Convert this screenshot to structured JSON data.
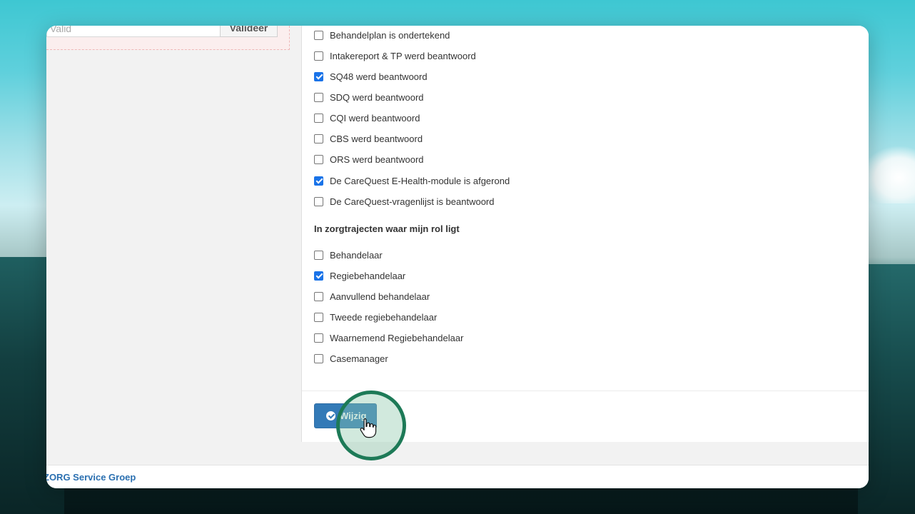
{
  "left_pane": {
    "validate_input_placeholder": "Valid",
    "validate_button_label": "Valideer"
  },
  "status_checkboxes": [
    {
      "label": "Behandelplan is ondertekend",
      "checked": false
    },
    {
      "label": "Intakereport & TP werd beantwoord",
      "checked": false
    },
    {
      "label": "SQ48 werd beantwoord",
      "checked": true
    },
    {
      "label": "SDQ werd beantwoord",
      "checked": false
    },
    {
      "label": "CQI werd beantwoord",
      "checked": false
    },
    {
      "label": "CBS werd beantwoord",
      "checked": false
    },
    {
      "label": "ORS werd beantwoord",
      "checked": false
    },
    {
      "label": "De CareQuest E-Health-module is afgerond",
      "checked": true
    },
    {
      "label": "De CareQuest-vragenlijst is beantwoord",
      "checked": false
    }
  ],
  "role_section": {
    "heading": "In zorgtrajecten waar mijn rol ligt",
    "roles": [
      {
        "label": "Behandelaar",
        "checked": false
      },
      {
        "label": "Regiebehandelaar",
        "checked": true
      },
      {
        "label": "Aanvullend behandelaar",
        "checked": false
      },
      {
        "label": "Tweede regiebehandelaar",
        "checked": false
      },
      {
        "label": "Waarnemend Regiebehandelaar",
        "checked": false
      },
      {
        "label": "Casemanager",
        "checked": false
      }
    ]
  },
  "form_footer": {
    "submit_label": "Wijzig",
    "submit_icon": "check-circle-icon"
  },
  "app_footer": {
    "brand": "ZORG Service Groep"
  },
  "colors": {
    "primary_button": "#337ab7",
    "checkbox_checked": "#1a73e8",
    "click_highlight": "#1d7a57",
    "footer_brand": "#2a6fb0"
  }
}
